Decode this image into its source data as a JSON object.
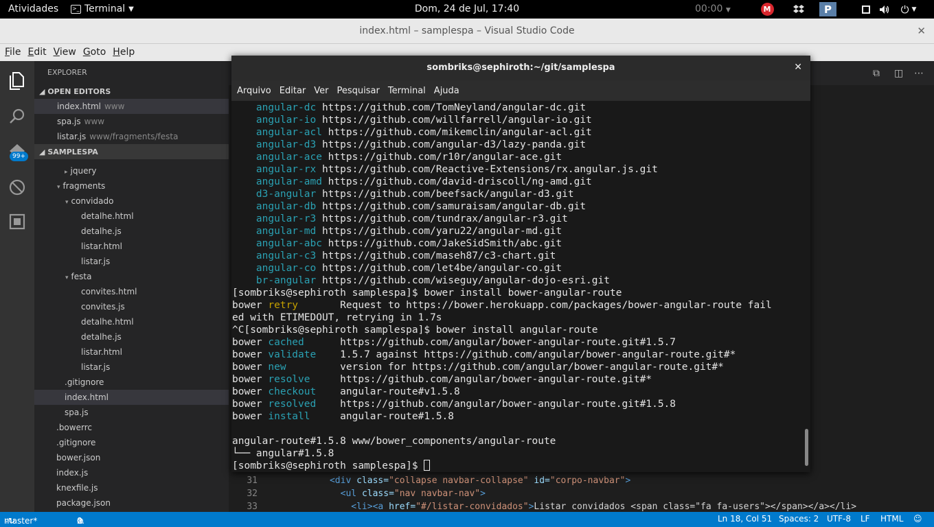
{
  "topbar": {
    "activities": "Atividades",
    "app_menu": "Terminal",
    "clock": "Dom, 24 de Jul, 17:40",
    "timer": "00:00"
  },
  "vscode": {
    "title": "index.html – samplespa – Visual Studio Code",
    "menu": [
      "File",
      "Edit",
      "View",
      "Goto",
      "Help"
    ],
    "badge": "99+",
    "explorer_header": "EXPLORER",
    "open_editors_label": "OPEN EDITORS",
    "project_label": "SAMPLESPA",
    "open_editors": [
      {
        "name": "index.html",
        "dir": "www"
      },
      {
        "name": "spa.js",
        "dir": "www"
      },
      {
        "name": "listar.js",
        "dir": "www/fragments/festa"
      }
    ],
    "tree": [
      {
        "name": "jquery",
        "arrow": "▸"
      },
      {
        "name": "fragments",
        "arrow": "▾"
      },
      {
        "name": "convidado",
        "arrow": "▾"
      },
      {
        "name": "detalhe.html",
        "arrow": ""
      },
      {
        "name": "detalhe.js",
        "arrow": ""
      },
      {
        "name": "listar.html",
        "arrow": ""
      },
      {
        "name": "listar.js",
        "arrow": ""
      },
      {
        "name": "festa",
        "arrow": "▾"
      },
      {
        "name": "convites.html",
        "arrow": ""
      },
      {
        "name": "convites.js",
        "arrow": ""
      },
      {
        "name": "detalhe.html",
        "arrow": ""
      },
      {
        "name": "detalhe.js",
        "arrow": ""
      },
      {
        "name": "listar.html",
        "arrow": ""
      },
      {
        "name": "listar.js",
        "arrow": ""
      },
      {
        "name": ".gitignore",
        "arrow": ""
      },
      {
        "name": "index.html",
        "arrow": ""
      },
      {
        "name": "spa.js",
        "arrow": ""
      },
      {
        "name": ".bowerrc",
        "arrow": ""
      },
      {
        "name": ".gitignore",
        "arrow": ""
      },
      {
        "name": "bower.json",
        "arrow": ""
      },
      {
        "name": "index.js",
        "arrow": ""
      },
      {
        "name": "knexfile.js",
        "arrow": ""
      },
      {
        "name": "package.json",
        "arrow": ""
      }
    ],
    "code": [
      {
        "ln": "31",
        "indent": "      ",
        "open": "<div ",
        "a1": "class=",
        "v1": "\"collapse navbar-collapse\"",
        "a2": " id=",
        "v2": "\"corpo-navbar\"",
        "close": ">",
        "rest": ""
      },
      {
        "ln": "32",
        "indent": "        ",
        "open": "<ul ",
        "a1": "class=",
        "v1": "\"nav navbar-nav\"",
        "a2": "",
        "v2": "",
        "close": ">",
        "rest": ""
      },
      {
        "ln": "33",
        "indent": "          ",
        "open": "<li><a ",
        "a1": "href=",
        "v1": "\"#/listar-convidados\"",
        "a2": "",
        "v2": "",
        "close": ">",
        "rest": "Listar convidados <span class=\"fa fa-users\"></span></a></li>"
      }
    ],
    "status": {
      "branch": "master*",
      "errors": "0",
      "warnings": "0",
      "position": "Ln 18, Col 51",
      "spaces": "Spaces: 2",
      "encoding": "UTF-8",
      "eol": "LF",
      "language": "HTML"
    }
  },
  "terminal": {
    "title": "sombriks@sephiroth:~/git/samplespa",
    "menu": [
      "Arquivo",
      "Editar",
      "Ver",
      "Pesquisar",
      "Terminal",
      "Ajuda"
    ],
    "lines": [
      {
        "c1": "    angular-dc",
        "t1": " https://github.com/TomNeyland/angular-dc.git",
        "s1": "cy"
      },
      {
        "c1": "    angular-io",
        "t1": " https://github.com/willfarrell/angular-io.git",
        "s1": "cy"
      },
      {
        "c1": "    angular-acl",
        "t1": " https://github.com/mikemclin/angular-acl.git",
        "s1": "cy"
      },
      {
        "c1": "    angular-d3",
        "t1": " https://github.com/angular-d3/lazy-panda.git",
        "s1": "cy"
      },
      {
        "c1": "    angular-ace",
        "t1": " https://github.com/r10r/angular-ace.git",
        "s1": "cy"
      },
      {
        "c1": "    angular-rx",
        "t1": " https://github.com/Reactive-Extensions/rx.angular.js.git",
        "s1": "cy"
      },
      {
        "c1": "    angular-amd",
        "t1": " https://github.com/david-driscoll/ng-amd.git",
        "s1": "cy"
      },
      {
        "c1": "    d3-angular",
        "t1": " https://github.com/beefsack/angular-d3.git",
        "s1": "cy"
      },
      {
        "c1": "    angular-db",
        "t1": " https://github.com/samuraisam/angular-db.git",
        "s1": "cy"
      },
      {
        "c1": "    angular-r3",
        "t1": " https://github.com/tundrax/angular-r3.git",
        "s1": "cy"
      },
      {
        "c1": "    angular-md",
        "t1": " https://github.com/yaru22/angular-md.git",
        "s1": "cy"
      },
      {
        "c1": "    angular-abc",
        "t1": " https://github.com/JakeSidSmith/abc.git",
        "s1": "cy"
      },
      {
        "c1": "    angular-c3",
        "t1": " https://github.com/maseh87/c3-chart.git",
        "s1": "cy"
      },
      {
        "c1": "    angular-co",
        "t1": " https://github.com/let4be/angular-co.git",
        "s1": "cy"
      },
      {
        "c1": "    br-angular",
        "t1": " https://github.com/wiseguy/angular-dojo-esri.git",
        "s1": "cy"
      },
      {
        "c1": "",
        "t1": "[sombriks@sephiroth samplespa]$ bower install bower-angular-route",
        "s1": ""
      },
      {
        "c1": "bower ",
        "c2": "retry",
        "t1": "       Request to https://bower.herokuapp.com/packages/bower-angular-route fail",
        "s1": "",
        "s2": "yl"
      },
      {
        "c1": "",
        "t1": "ed with ETIMEDOUT, retrying in 1.7s",
        "s1": ""
      },
      {
        "c1": "",
        "t1": "^C[sombriks@sephiroth samplespa]$ bower install angular-route",
        "s1": ""
      },
      {
        "c1": "bower ",
        "c2": "cached",
        "t1": "      https://github.com/angular/bower-angular-route.git#1.5.7",
        "s2": "cy"
      },
      {
        "c1": "bower ",
        "c2": "validate",
        "t1": "    1.5.7 against https://github.com/angular/bower-angular-route.git#*",
        "s2": "cy"
      },
      {
        "c1": "bower ",
        "c2": "new",
        "t1": "         version for https://github.com/angular/bower-angular-route.git#*",
        "s2": "cy"
      },
      {
        "c1": "bower ",
        "c2": "resolve",
        "t1": "     https://github.com/angular/bower-angular-route.git#*",
        "s2": "cy"
      },
      {
        "c1": "bower ",
        "c2": "checkout",
        "t1": "    angular-route#v1.5.8",
        "s2": "cy"
      },
      {
        "c1": "bower ",
        "c2": "resolved",
        "t1": "    https://github.com/angular/bower-angular-route.git#1.5.8",
        "s2": "cy"
      },
      {
        "c1": "bower ",
        "c2": "install",
        "t1": "     angular-route#1.5.8",
        "s2": "cy"
      },
      {
        "c1": "",
        "t1": "",
        "s1": ""
      },
      {
        "c1": "",
        "t1": "angular-route#1.5.8 www/bower_components/angular-route",
        "s1": ""
      },
      {
        "c1": "",
        "t1": "└── angular#1.5.8",
        "s1": ""
      },
      {
        "c1": "",
        "t1": "[sombriks@sephiroth samplespa]$ ",
        "s1": "",
        "cursor": true
      }
    ]
  },
  "colors": {
    "vscode_blue": "#007acc",
    "terminal_cyan": "#2aa1b3",
    "terminal_yellow": "#c4a000"
  }
}
